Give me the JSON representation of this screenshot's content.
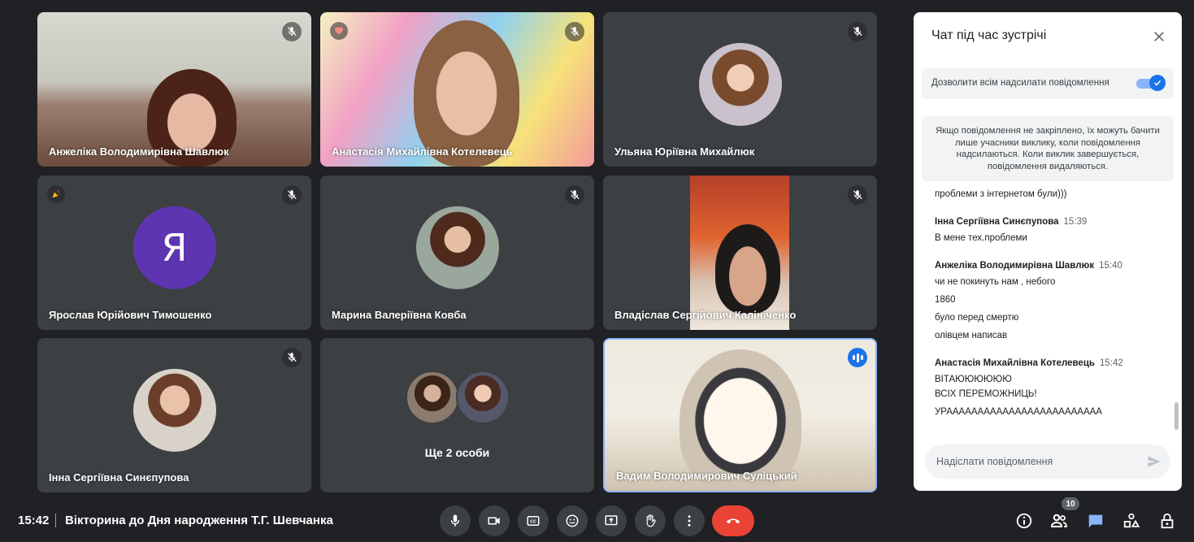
{
  "participants": [
    {
      "name": "Анжеліка Володимирівна Шавлюк"
    },
    {
      "name": "Анастасія Михайлівна Котелевець"
    },
    {
      "name": "Ульяна Юріївна Михайлюк"
    },
    {
      "name": "Ярослав Юрійович Тимошенко",
      "initial": "Я"
    },
    {
      "name": "Марина Валеріївна Ковба"
    },
    {
      "name": "Владіслав Сергійович Калініченко"
    },
    {
      "name": "Інна Сергіївна Синєпупова"
    },
    {
      "name": "Вадим Володимирович Суліцький"
    }
  ],
  "more_tile": {
    "label": "Ще 2 особи"
  },
  "chat": {
    "title": "Чат під час зустрічі",
    "allow_all_label": "Дозволити всім надсилати повідомлення",
    "allow_all_enabled": true,
    "notice": "Якщо повідомлення не закріплено, їх можуть бачити лише учасники виклику, коли повідомлення надсилаються. Коли виклик завершується, повідомлення видаляються.",
    "messages": [
      {
        "sender": "",
        "time": "",
        "lines": [
          "проблеми з інтернетом були)))"
        ]
      },
      {
        "sender": "Інна Сергіївна Синєпупова",
        "time": "15:39",
        "lines": [
          "В мене тех.проблеми"
        ]
      },
      {
        "sender": "Анжеліка Володимирівна Шавлюк",
        "time": "15:40",
        "lines": [
          "чи не покинуть нам , небого",
          "1860",
          "було перед смертю",
          "олівцем написав"
        ]
      },
      {
        "sender": "Анастасія Михайлівна Котелевець",
        "time": "15:42",
        "lines": [
          "ВІТАЮЮЮЮЮЮ",
          "ВСІХ ПЕРЕМОЖНИЦЬ!",
          "УРААААААААААААААААААААААААА"
        ]
      }
    ],
    "input_placeholder": "Надіслати повідомлення"
  },
  "footer": {
    "time": "15:42",
    "meeting_title": "Вікторина до Дня народження Т.Г. Шевчанка",
    "participant_count": "10"
  },
  "colors": {
    "accent": "#1a73e8",
    "end_call": "#ea4335",
    "background": "#202124",
    "tile": "#3c4043"
  },
  "icons": {
    "controls": [
      "microphone-icon",
      "camera-icon",
      "captions-icon",
      "emoji-icon",
      "present-icon",
      "raise-hand-icon",
      "more-options-icon",
      "end-call-icon"
    ],
    "right": [
      "info-icon",
      "people-icon",
      "chat-icon",
      "activities-icon",
      "host-controls-icon"
    ]
  }
}
